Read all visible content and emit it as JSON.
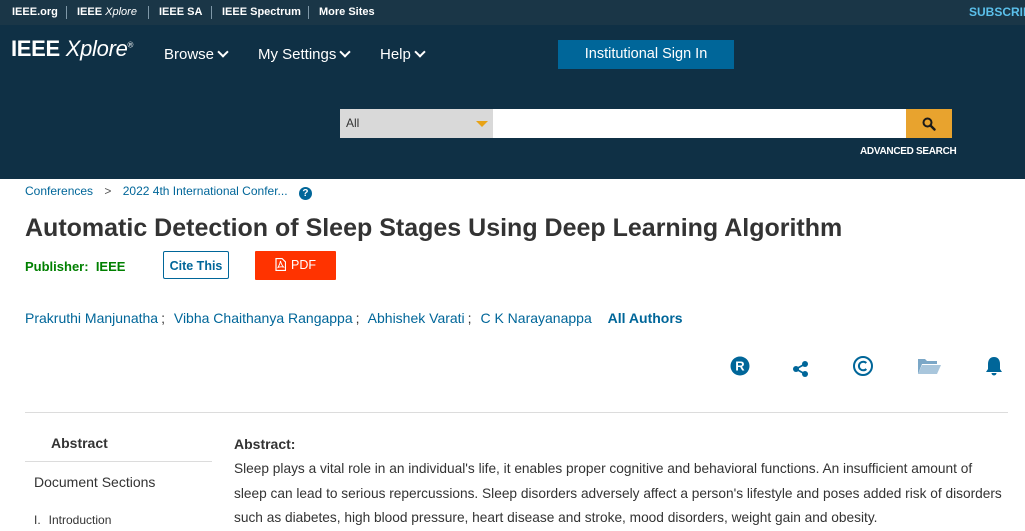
{
  "topbar": {
    "links": [
      "IEEE.org",
      "IEEE Xplore",
      "IEEE SA",
      "IEEE Spectrum",
      "More Sites"
    ],
    "subscribe": "SUBSCRIBE"
  },
  "header": {
    "logo_ieee": "IEEE",
    "logo_xplore": "Xplore",
    "logo_mark": "®",
    "nav": [
      "Browse",
      "My Settings",
      "Help"
    ],
    "signin_label": "Institutional Sign In",
    "search": {
      "scope": "All",
      "query": "",
      "button_icon": "search-icon"
    },
    "advanced_search": "ADVANCED SEARCH"
  },
  "breadcrumb": {
    "items": [
      "Conferences",
      "2022 4th International Confer..."
    ],
    "separator": ">",
    "help_icon": "?"
  },
  "article": {
    "title": "Automatic Detection of Sleep Stages Using Deep Learning Algorithm",
    "publisher_label": "Publisher:",
    "publisher": "IEEE",
    "cite_label": "Cite This",
    "pdf_label": "PDF",
    "authors": [
      "Prakruthi Manjunatha",
      "Vibha Chaithanya Rangappa",
      "Abhishek Varati",
      "C K Narayanappa"
    ],
    "author_separator": ";",
    "all_authors": "All Authors",
    "tools": [
      "rights-icon",
      "share-icon",
      "copyright-icon",
      "folder-icon",
      "alert-bell-icon"
    ]
  },
  "sidebar": {
    "active": "Abstract",
    "sections_title": "Document Sections",
    "items": [
      {
        "num": "I.",
        "label": "Introduction"
      }
    ]
  },
  "abstract": {
    "heading": "Abstract:",
    "text": "Sleep plays a vital role in an individual's life, it enables proper cognitive and behavioral functions. An insufficient amount of sleep can lead to serious repercussions. Sleep disorders adversely affect a person's lifestyle and poses added risk of disorders such as diabetes, high blood pressure, heart disease and stroke, mood disorders, weight gain and obesity."
  },
  "colors": {
    "topbar": "#1a3647",
    "header": "#0f3045",
    "link": "#006699",
    "publisher": "#008000",
    "pdf": "#ff3300",
    "search_button": "#e8a32e"
  }
}
